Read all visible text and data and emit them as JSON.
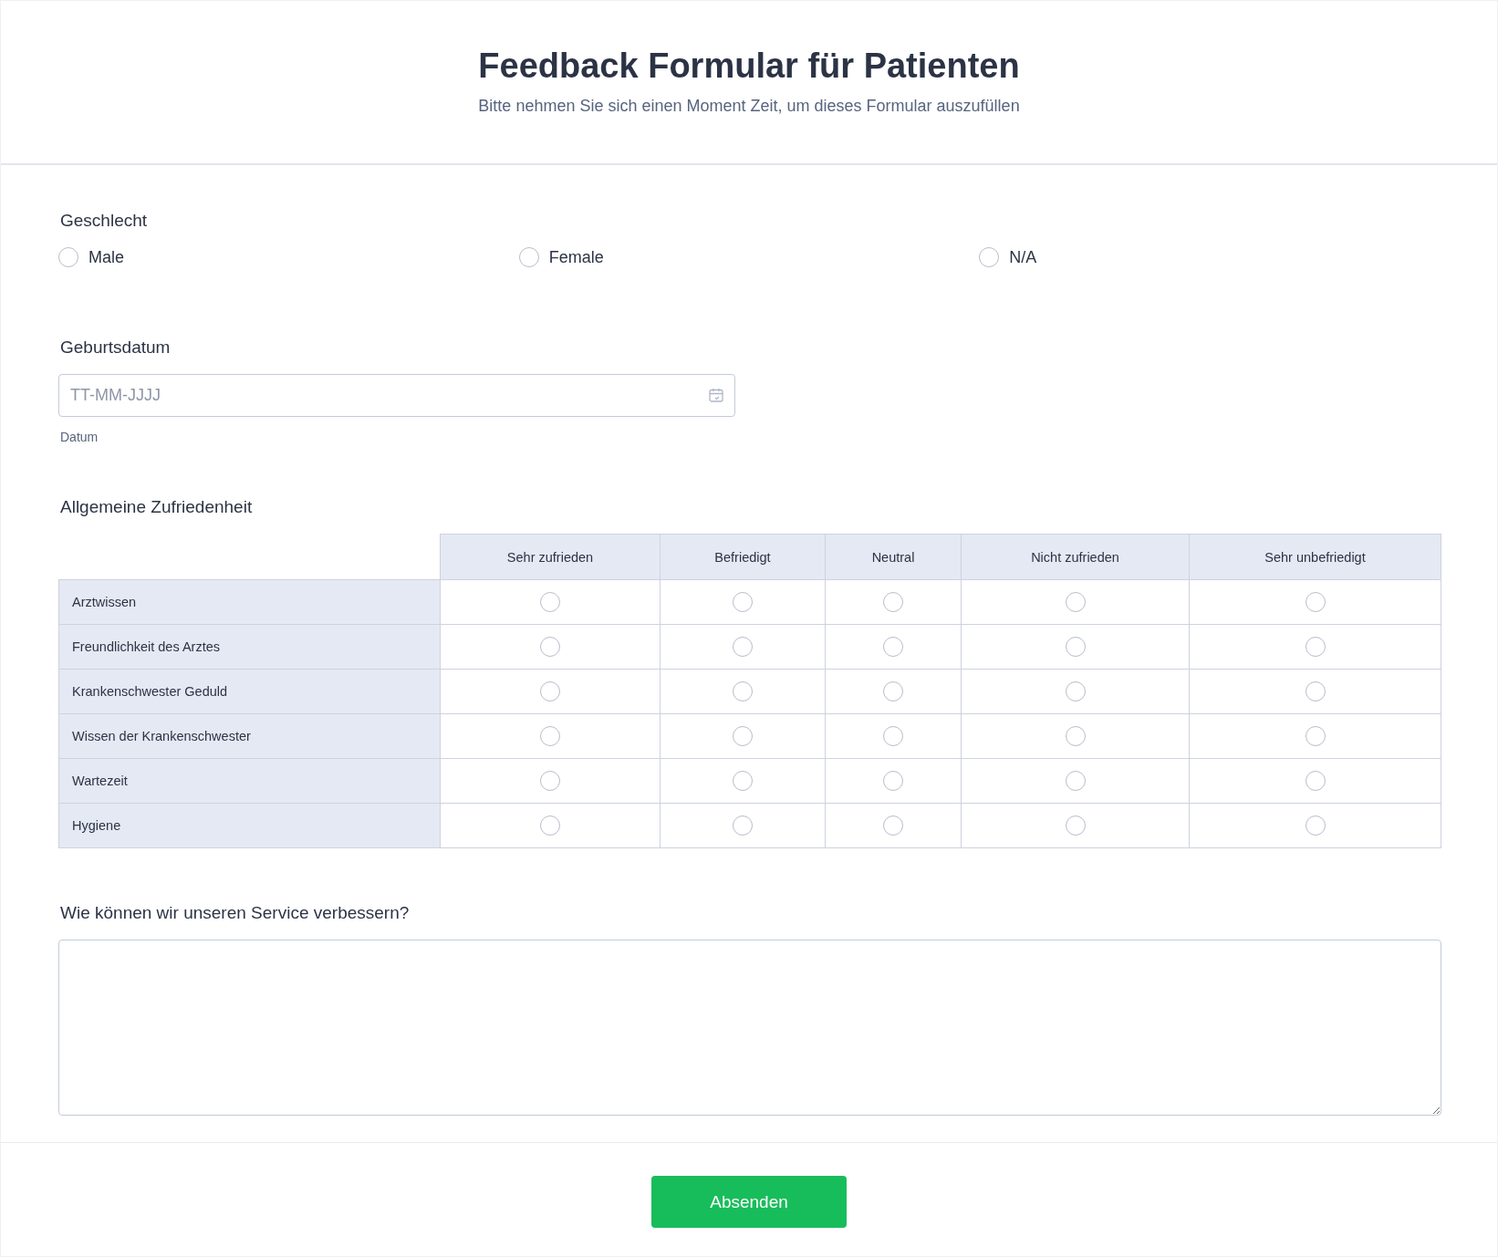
{
  "header": {
    "title": "Feedback Formular für Patienten",
    "subtitle": "Bitte nehmen Sie sich einen Moment Zeit, um dieses Formular auszufüllen"
  },
  "gender": {
    "label": "Geschlecht",
    "options": [
      {
        "label": "Male",
        "selected": false
      },
      {
        "label": "Female",
        "selected": false
      },
      {
        "label": "N/A",
        "selected": false
      }
    ]
  },
  "birthdate": {
    "label": "Geburtsdatum",
    "placeholder": "TT-MM-JJJJ",
    "sublabel": "Datum"
  },
  "satisfaction": {
    "label": "Allgemeine Zufriedenheit",
    "columns": [
      "Sehr zufrieden",
      "Befriedigt",
      "Neutral",
      "Nicht zufrieden",
      "Sehr unbefriedigt"
    ],
    "rows": [
      {
        "label": "Arztwissen",
        "checked": [
          false,
          false,
          false,
          false,
          false
        ]
      },
      {
        "label": "Freundlichkeit des Arztes",
        "checked": [
          false,
          false,
          false,
          false,
          false
        ]
      },
      {
        "label": "Krankenschwester Geduld",
        "checked": [
          false,
          false,
          false,
          false,
          false
        ]
      },
      {
        "label": "Wissen der Krankenschwester",
        "checked": [
          false,
          false,
          false,
          false,
          false
        ]
      },
      {
        "label": "Wartezeit",
        "checked": [
          false,
          false,
          false,
          false,
          false
        ]
      },
      {
        "label": "Hygiene",
        "checked": [
          false,
          false,
          false,
          false,
          false
        ]
      }
    ]
  },
  "improve": {
    "label": "Wie können wir unseren Service verbessern?"
  },
  "submit": "Absenden"
}
